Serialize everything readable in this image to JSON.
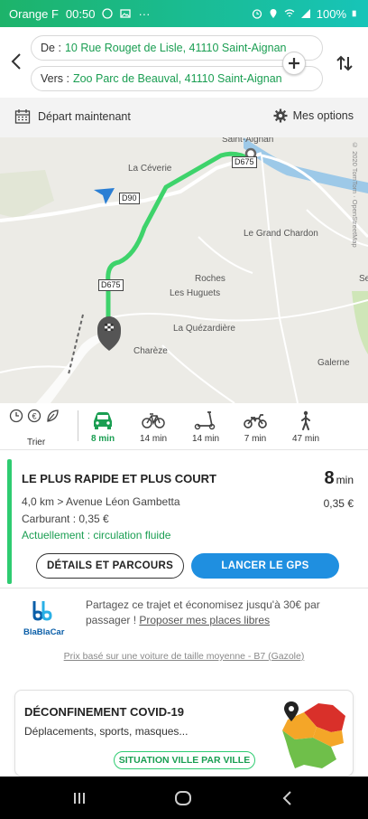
{
  "status_bar": {
    "carrier": "Orange F",
    "time": "00:50",
    "dots": "···",
    "battery": "100%"
  },
  "route": {
    "from_label": "De :",
    "from_value": "10 Rue Rouget de Lisle, 41110 Saint-Aignan",
    "to_label": "Vers :",
    "to_value": "Zoo Parc de Beauval, 41110 Saint-Aignan"
  },
  "options": {
    "depart": "Départ maintenant",
    "my_options": "Mes options"
  },
  "map": {
    "labels": {
      "saint_aignan": "Saint-Aignan",
      "la_ceverie": "La Céverie",
      "le_grand_chardon": "Le Grand Chardon",
      "roches": "Roches",
      "les_huguets": "Les Huguets",
      "la_quezardiere": "La Quézardière",
      "chareze": "Charèze",
      "galerne": "Galerne",
      "se": "Se"
    },
    "roads": {
      "d675_top": "D675",
      "d90": "D90",
      "d675_mid": "D675"
    },
    "credit": "© 2020 TomTom · OpenStreetMap"
  },
  "modes": {
    "sort_label": "Trier",
    "car": "8 min",
    "bike": "14 min",
    "scooter": "14 min",
    "moto": "7 min",
    "walk": "47 min"
  },
  "result": {
    "title": "LE PLUS RAPIDE ET PLUS COURT",
    "time_value": "8",
    "time_unit": "min",
    "distance": "4,0 km  >  Avenue Léon Gambetta",
    "cost": "0,35 €",
    "fuel": "Carburant : 0,35 €",
    "traffic": "Actuellement : circulation fluide",
    "details_btn": "DÉTAILS ET PARCOURS",
    "gps_btn": "LANCER LE GPS"
  },
  "blablacar": {
    "logo_text": "BlaBlaCar",
    "text": "Partagez ce trajet et économisez jusqu'à 30€ par passager ! ",
    "link": "Proposer mes places libres"
  },
  "price_note": "Prix basé sur une voiture de taille moyenne - B7 (Gazole)",
  "covid": {
    "title": "DÉCONFINEMENT COVID-19",
    "subtitle": "Déplacements, sports, masques...",
    "button": "SITUATION VILLE PAR VILLE"
  },
  "colors": {
    "accent_green": "#1a9e52",
    "route_green": "#2ecc71",
    "gps_blue": "#1f8fe0"
  }
}
